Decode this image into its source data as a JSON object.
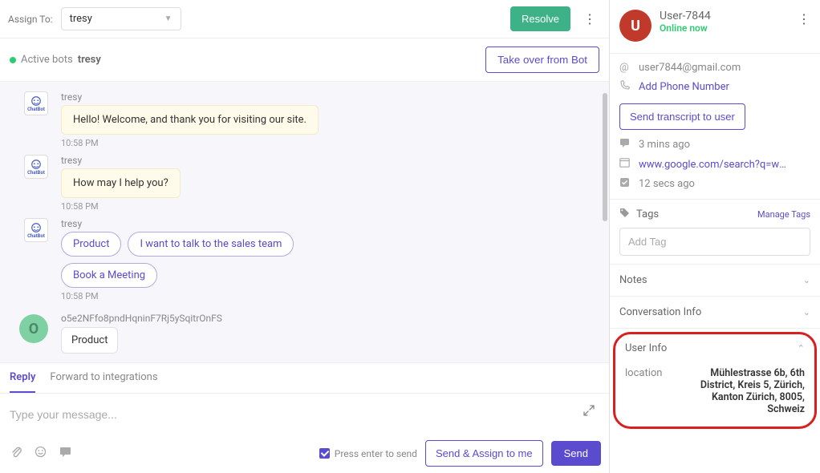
{
  "toolbar": {
    "assign_label": "Assign To:",
    "assignee": "tresy",
    "resolve": "Resolve"
  },
  "botbar": {
    "label": "Active bots",
    "name": "tresy",
    "takeover": "Take over from Bot"
  },
  "chat": {
    "m1": {
      "sender": "tresy",
      "text": "Hello! Welcome, and thank you for visiting our site.",
      "ts": "10:58 PM"
    },
    "m2": {
      "sender": "tresy",
      "text": "How may I help you?",
      "ts": "10:58 PM"
    },
    "m3": {
      "sender": "tresy",
      "chip1": "Product",
      "chip2": "I want to talk to the sales team",
      "chip3": "Book a Meeting",
      "ts": "10:58 PM"
    },
    "m4": {
      "userid": "o5e2NFfo8pndHqninF7Rj5ySqitrOnFS",
      "text": "Product"
    },
    "avatar_initial": "O",
    "bot_sub": "ChatBot"
  },
  "composer": {
    "tab_reply": "Reply",
    "tab_forward": "Forward to integrations",
    "placeholder": "Type your message...",
    "enter_label": "Press enter to send",
    "send_assign": "Send & Assign to me",
    "send": "Send"
  },
  "sidebar": {
    "avatar_initial": "U",
    "username": "User-7844",
    "status": "Online now",
    "email": "user7844@gmail.com",
    "add_phone": "Add Phone Number",
    "send_transcript": "Send transcript to user",
    "ago1": "3 mins ago",
    "url": "www.google.com/search?q=weath…",
    "ago2": "12 secs ago",
    "tags_label": "Tags",
    "manage_tags": "Manage Tags",
    "add_tag_placeholder": "Add Tag",
    "notes_label": "Notes",
    "convo_info_label": "Conversation Info",
    "userinfo_label": "User Info",
    "loc_key": "location",
    "loc_val": "Mühlestrasse 6b, 6th District, Kreis 5, Zürich, Kanton Zürich, 8005, Schweiz"
  }
}
